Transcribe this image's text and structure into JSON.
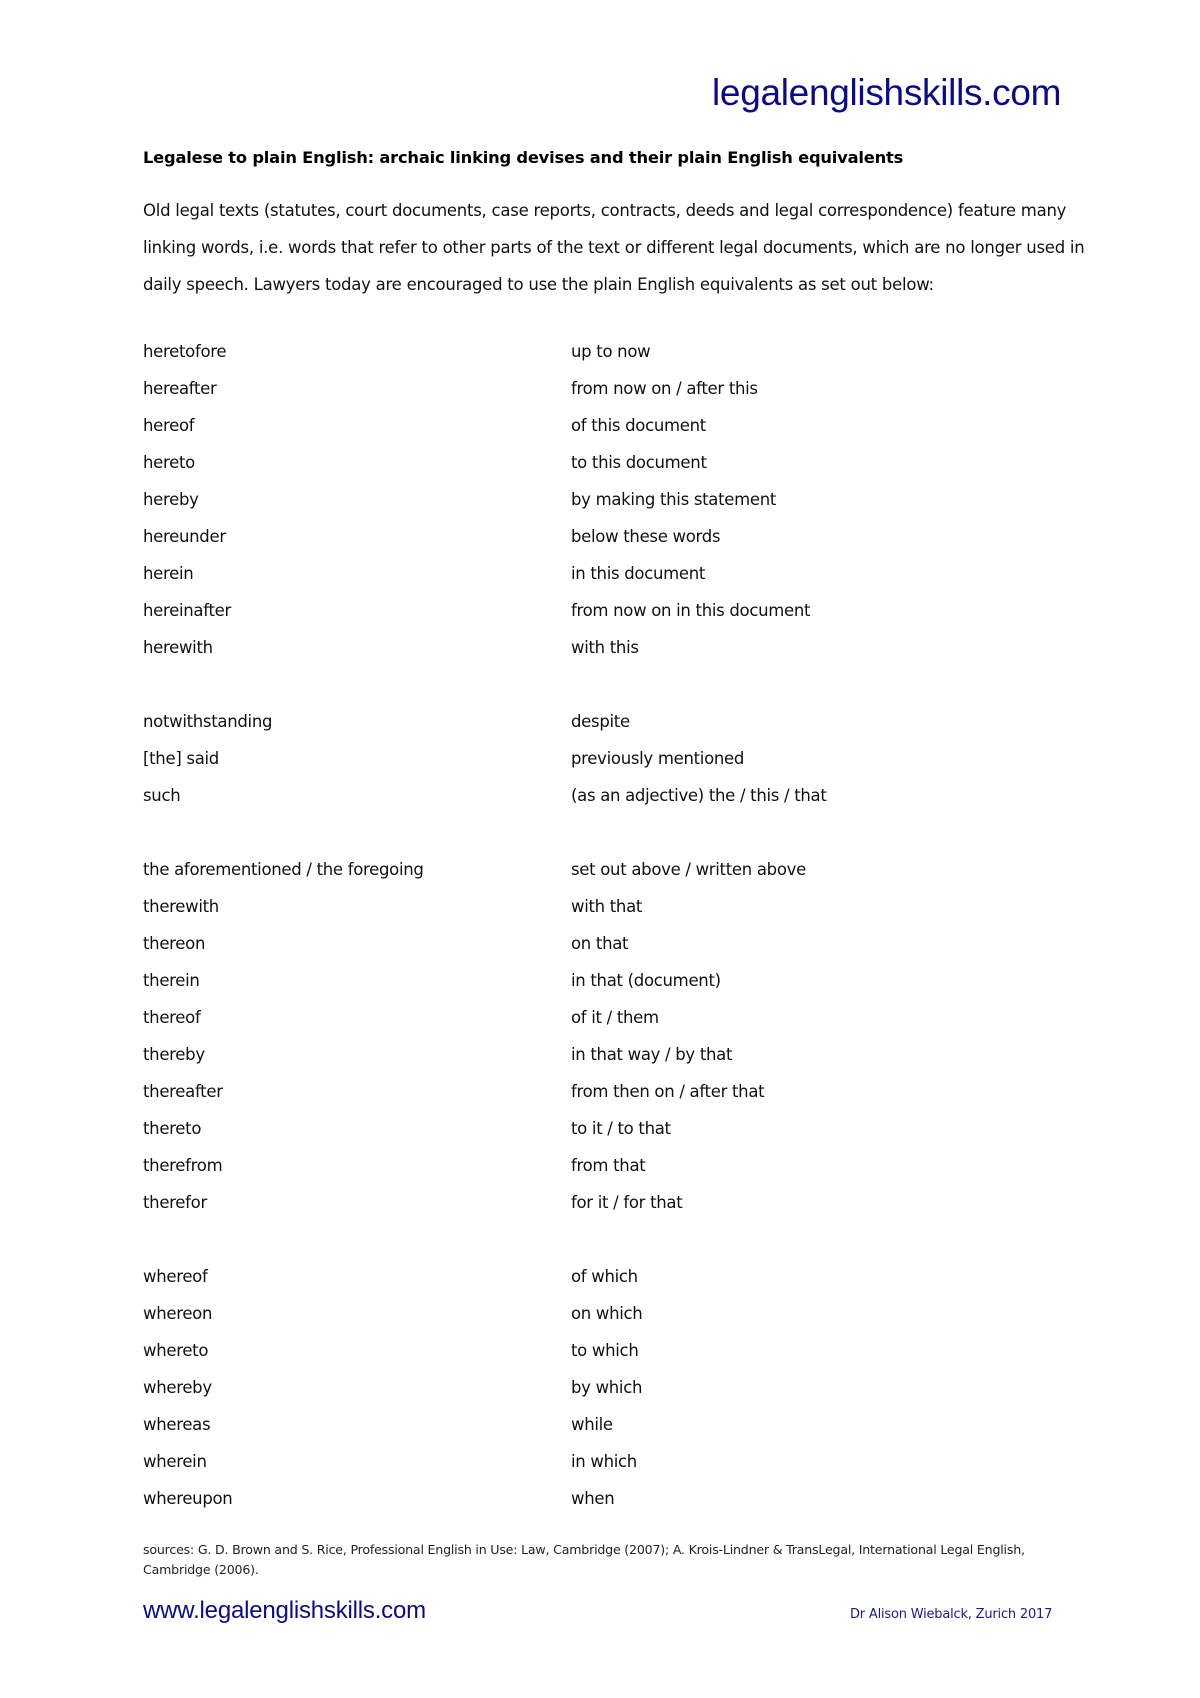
{
  "header": {
    "brand": "legalenglishskills.com"
  },
  "title": "Legalese to plain English: archaic linking devises and their plain English equivalents",
  "intro_lines": [
    "Old legal texts (statutes, court documents, case reports, contracts, deeds and legal correspondence) feature many",
    "linking words, i.e. words that refer to other parts of the text or different legal documents, which are no longer used in",
    "daily speech. Lawyers today are encouraged to use the plain English equivalents as set out below:"
  ],
  "groups": [
    [
      {
        "term": "heretofore",
        "plain": "up to now"
      },
      {
        "term": "hereafter",
        "plain": "from now on / after this"
      },
      {
        "term": "hereof",
        "plain": "of this document"
      },
      {
        "term": "hereto",
        "plain": "to this document"
      },
      {
        "term": "hereby",
        "plain": "by making this statement"
      },
      {
        "term": "hereunder",
        "plain": "below these words"
      },
      {
        "term": "herein",
        "plain": "in this document"
      },
      {
        "term": "hereinafter",
        "plain": "from now on in this document"
      },
      {
        "term": "herewith",
        "plain": "with this"
      }
    ],
    [
      {
        "term": "notwithstanding",
        "plain": "despite"
      },
      {
        "term": "[the] said",
        "plain": "previously mentioned"
      },
      {
        "term": "such",
        "plain": "(as an adjective) the / this / that"
      }
    ],
    [
      {
        "term": "the aforementioned / the foregoing",
        "plain": "set out above / written above"
      },
      {
        "term": "therewith",
        "plain": "with that"
      },
      {
        "term": "thereon",
        "plain": "on that"
      },
      {
        "term": "therein",
        "plain": "in that (document)"
      },
      {
        "term": "thereof",
        "plain": "of it / them"
      },
      {
        "term": "thereby",
        "plain": "in that way / by that"
      },
      {
        "term": "thereafter",
        "plain": "from then on / after that"
      },
      {
        "term": "thereto",
        "plain": "to it / to that"
      },
      {
        "term": "therefrom",
        "plain": "from that"
      },
      {
        "term": "therefor",
        "plain": "for it / for that"
      }
    ],
    [
      {
        "term": "whereof",
        "plain": "of which"
      },
      {
        "term": "whereon",
        "plain": "on which"
      },
      {
        "term": "whereto",
        "plain": "to which"
      },
      {
        "term": "whereby",
        "plain": "by which"
      },
      {
        "term": "whereas",
        "plain": "while"
      },
      {
        "term": "wherein",
        "plain": "in which"
      },
      {
        "term": "whereupon",
        "plain": "when"
      }
    ]
  ],
  "sources_lines": [
    "sources: G. D. Brown and S. Rice, Professional English in Use: Law, Cambridge (2007); A. Krois-Lindner & TransLegal, International Legal English,",
    "Cambridge (2006)."
  ],
  "footer": {
    "website": "www.legalenglishskills.com",
    "author": "Dr Alison Wiebalck, Zurich 2017"
  },
  "colors": {
    "brand_blue": "#0b0b8a"
  }
}
